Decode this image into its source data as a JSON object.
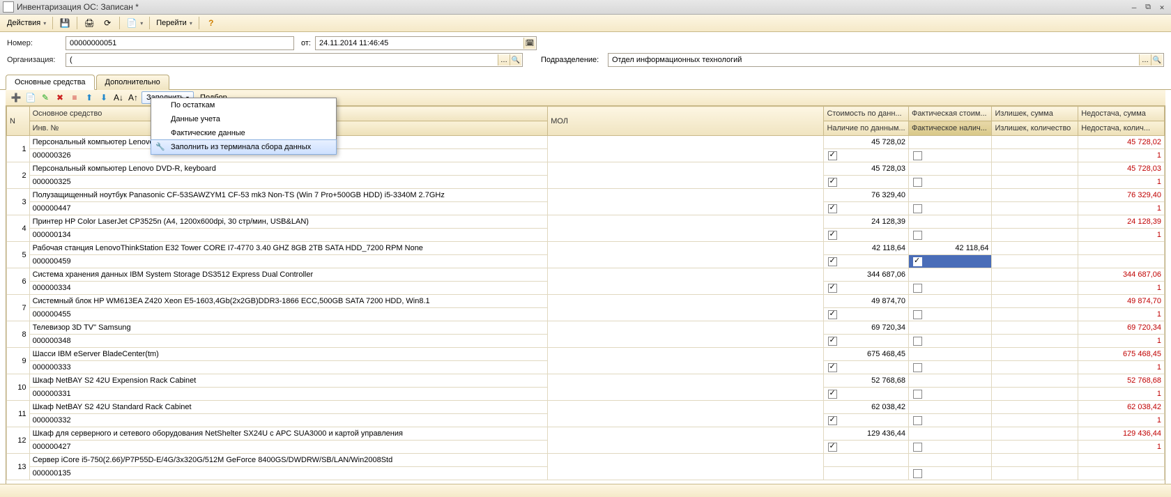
{
  "window": {
    "title": "Инвентаризация ОС: Записан *"
  },
  "toolbar": {
    "actions": "Действия",
    "goto": "Перейти"
  },
  "form": {
    "number_label": "Номер:",
    "number": "00000000051",
    "from_label": "от:",
    "date": "24.11.2014 11:46:45",
    "org_label": "Организация:",
    "org": "(",
    "dept_label": "Подразделение:",
    "dept": "Отдел информационных технологий"
  },
  "tabs": {
    "main": "Основные средства",
    "extra": "Дополнительно"
  },
  "subtb": {
    "fill": "Заполнить",
    "select": "Подбор"
  },
  "dropdown": {
    "i1": "По остаткам",
    "i2": "Данные учета",
    "i3": "Фактические данные",
    "i4": "Заполнить из терминала сбора данных"
  },
  "headers": {
    "n": "N",
    "asset": "Основное средство",
    "inv": "Инв. №",
    "mol": "МОЛ",
    "cost1": "Стоимость по данн...",
    "cost2": "Фактическая стоим...",
    "surplus": "Излишек, сумма",
    "shortage": "Недостача, сумма",
    "avail1": "Наличие по данным...",
    "avail2": "Фактическое налич...",
    "surplus_q": "Излишек, количество",
    "shortage_q": "Недостача, колич..."
  },
  "rows": [
    {
      "n": "1",
      "name": "Персональный компьютер Lenovo                                                              DVD-R, keyboard",
      "inv": "000000326",
      "cost1": "45 728,02",
      "cost2": "",
      "s": "",
      "d": "45 728,02",
      "a1": true,
      "a2": false,
      "sq": "",
      "dq": "1"
    },
    {
      "n": "2",
      "name": "Персональный компьютер Lenovo                                                              DVD-R, keyboard",
      "inv": "000000325",
      "cost1": "45 728,03",
      "cost2": "",
      "s": "",
      "d": "45 728,03",
      "a1": true,
      "a2": false,
      "sq": "",
      "dq": "1"
    },
    {
      "n": "3",
      "name": "Полузащищенный ноутбук Panasonic CF-53SAWZYM1 CF-53 mk3 Non-TS (Win 7 Pro+500GB HDD) i5-3340M 2.7GHz",
      "inv": "000000447",
      "cost1": "76 329,40",
      "cost2": "",
      "s": "",
      "d": "76 329,40",
      "a1": true,
      "a2": false,
      "sq": "",
      "dq": "1"
    },
    {
      "n": "4",
      "name": "Принтер HP Color LaserJet CP3525n (A4, 1200x600dpi, 30 стр/мин, USB&LAN)",
      "inv": "000000134",
      "cost1": "24 128,39",
      "cost2": "",
      "s": "",
      "d": "24 128,39",
      "a1": true,
      "a2": false,
      "sq": "",
      "dq": "1"
    },
    {
      "n": "5",
      "name": "Рабочая станция LenovoThinkStation E32 Tower CORE I7-4770 3.40 GHZ 8GB 2TB SATA HDD_7200 RPM None",
      "inv": "000000459",
      "cost1": "42 118,64",
      "cost2": "42 118,64",
      "s": "",
      "d": "",
      "a1": true,
      "a2": true,
      "sq": "",
      "dq": "",
      "sel": true
    },
    {
      "n": "6",
      "name": "Система хранения данных IBM System Storage DS3512 Express Dual Controller",
      "inv": "000000334",
      "cost1": "344 687,06",
      "cost2": "",
      "s": "",
      "d": "344 687,06",
      "a1": true,
      "a2": false,
      "sq": "",
      "dq": "1"
    },
    {
      "n": "7",
      "name": "Системный блок HP WM613EA Z420 Xeon E5-1603,4Gb(2x2GB)DDR3-1866 ECC,500GB SATA 7200 HDD, Win8.1",
      "inv": "000000455",
      "cost1": "49 874,70",
      "cost2": "",
      "s": "",
      "d": "49 874,70",
      "a1": true,
      "a2": false,
      "sq": "",
      "dq": "1"
    },
    {
      "n": "8",
      "name": "Телевизор 3D TV\" Samsung",
      "inv": "000000348",
      "cost1": "69 720,34",
      "cost2": "",
      "s": "",
      "d": "69 720,34",
      "a1": true,
      "a2": false,
      "sq": "",
      "dq": "1"
    },
    {
      "n": "9",
      "name": "Шасси IBM eServer BladeCenter(tm)",
      "inv": "000000333",
      "cost1": "675 468,45",
      "cost2": "",
      "s": "",
      "d": "675 468,45",
      "a1": true,
      "a2": false,
      "sq": "",
      "dq": "1"
    },
    {
      "n": "10",
      "name": "Шкаф NetBAY S2 42U Expension Rack Cabinet",
      "inv": "000000331",
      "cost1": "52 768,68",
      "cost2": "",
      "s": "",
      "d": "52 768,68",
      "a1": true,
      "a2": false,
      "sq": "",
      "dq": "1"
    },
    {
      "n": "11",
      "name": "Шкаф NetBAY S2 42U Standard Rack Cabinet",
      "inv": "000000332",
      "cost1": "62 038,42",
      "cost2": "",
      "s": "",
      "d": "62 038,42",
      "a1": true,
      "a2": false,
      "sq": "",
      "dq": "1"
    },
    {
      "n": "12",
      "name": "Шкаф для серверного и сетевого оборудования NetShelter SX24U с APC SUA3000 и картой управления",
      "inv": "000000427",
      "cost1": "129 436,44",
      "cost2": "",
      "s": "",
      "d": "129 436,44",
      "a1": true,
      "a2": false,
      "sq": "",
      "dq": "1"
    },
    {
      "n": "13",
      "name": "Сервер iCore i5-750(2.66)/P7P55D-E/4G/3x320G/512M GeForce 8400GS/DWDRW/SB/LAN/Win2008Std",
      "inv": "000000135",
      "cost1": "",
      "cost2": "",
      "s": "",
      "d": "",
      "a1": false,
      "a2": false,
      "sq": "",
      "dq": "",
      "noA1": true
    }
  ]
}
